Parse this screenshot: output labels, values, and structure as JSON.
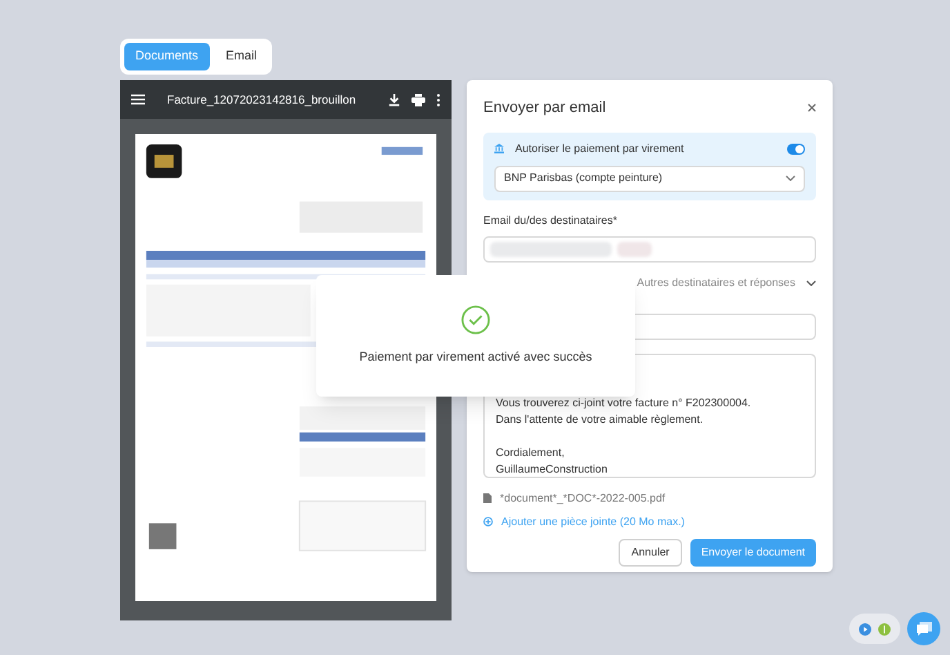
{
  "tabs": [
    {
      "label": "Documents",
      "selected": true
    },
    {
      "label": "Email",
      "selected": false
    }
  ],
  "viewer": {
    "title": "Facture_12072023142816_brouillon"
  },
  "modal": {
    "title": "Envoyer par email",
    "payment": {
      "label": "Autoriser le paiement par virement",
      "on": true,
      "account": "BNP Parisbas (compte peinture)"
    },
    "recipients": {
      "label": "Email du/des destinataires*"
    },
    "more_link": "Autres destinataires et réponses",
    "message_paragraphs": [
      [
        "Vous trouverez ci-joint votre facture n° F202300004.",
        "Dans l'attente de votre aimable règlement."
      ],
      [
        "Cordialement,",
        "GuillaumeConstruction"
      ]
    ],
    "attachment": "*document*_*DOC*-2022-005.pdf",
    "add_attachment": "Ajouter une pièce jointe (20 Mo max.)",
    "buttons": [
      {
        "label": "Annuler",
        "kind": "secondary"
      },
      {
        "label": "Envoyer le document",
        "kind": "primary"
      }
    ]
  },
  "toast": {
    "message": "Paiement par virement activé avec succès"
  }
}
